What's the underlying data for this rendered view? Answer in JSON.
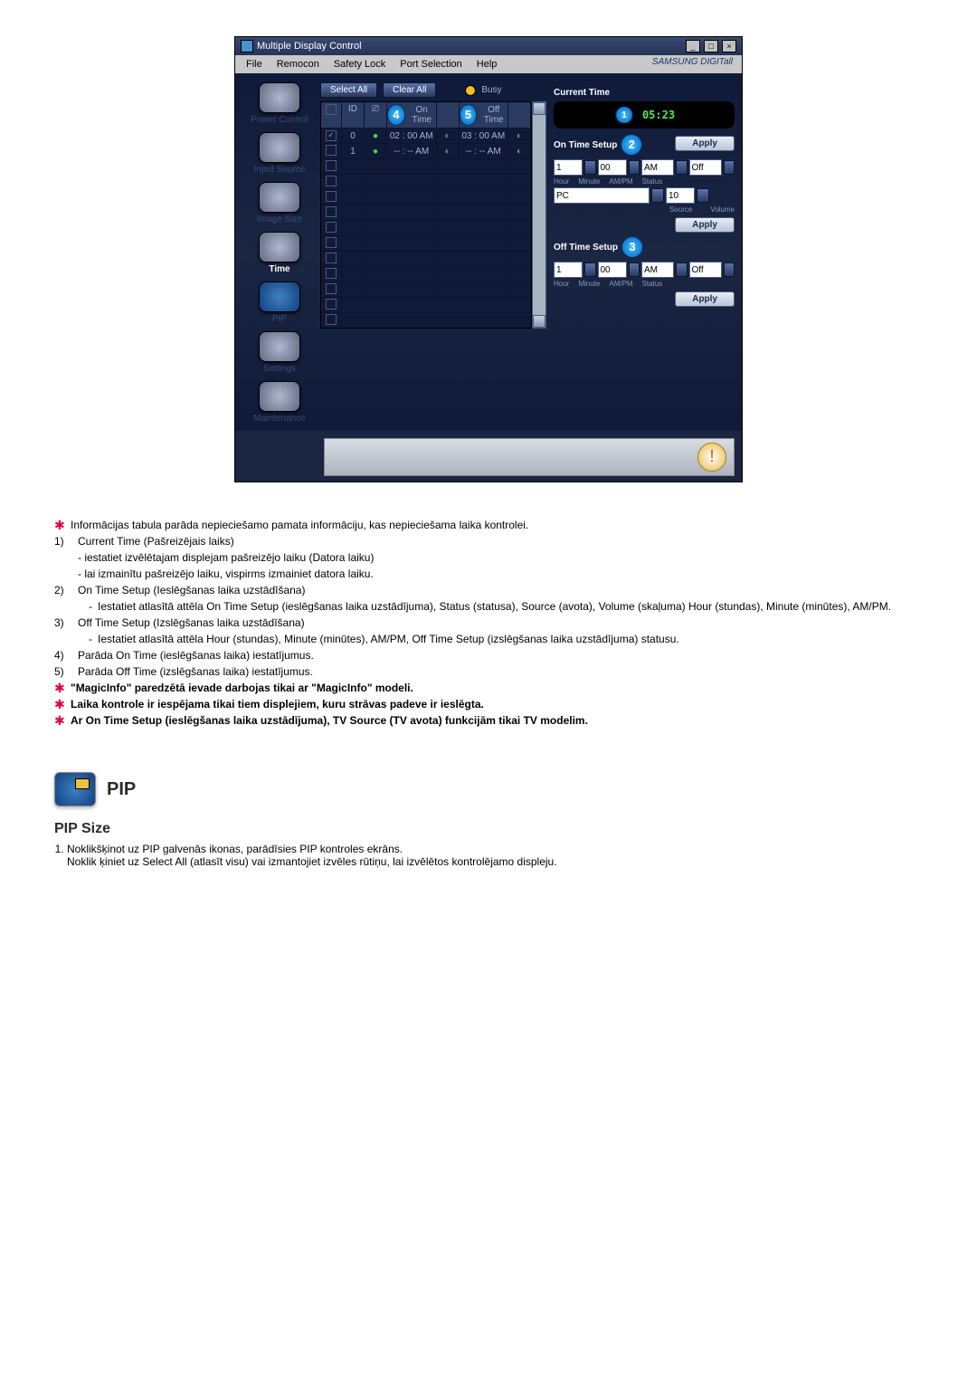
{
  "window": {
    "title": "Multiple Display Control",
    "menu": {
      "file": "File",
      "remocon": "Remocon",
      "safety": "Safety Lock",
      "port": "Port Selection",
      "help": "Help"
    },
    "brand": "SAMSUNG DIGITall"
  },
  "sidebar": {
    "power": "Power Control",
    "input": "Input Source",
    "image": "Image Size",
    "time": "Time",
    "pip": "PIP",
    "settings": "Settings",
    "maint": "Maintenance"
  },
  "top": {
    "selectAll": "Select All",
    "clearAll": "Clear All",
    "busy": "Busy",
    "head": {
      "id": "ID",
      "onTime": "On Time",
      "offTime": "Off Time"
    },
    "rows": [
      {
        "id": "0",
        "on": "02 : 00 AM",
        "off": "03 : 00 AM"
      },
      {
        "id": "1",
        "on": "-- : -- AM",
        "off": "-- : -- AM"
      }
    ]
  },
  "panel": {
    "currentTime": "Current Time",
    "time": "05:23",
    "apply": "Apply",
    "onSetup": "On Time Setup",
    "offSetup": "Off Time Setup",
    "hour": "Hour",
    "minute": "Minute",
    "ampm": "AM/PM",
    "status": "Status",
    "source": "Source",
    "volume": "Volume",
    "v": {
      "h": "1",
      "m": "00",
      "ap": "AM",
      "st": "Off",
      "src": "PC",
      "vol": "10"
    }
  },
  "doc": {
    "intro": "Informācijas tabula parāda nepieciešamo pamata informāciju, kas nepieciešama laika kontrolei.",
    "p1": {
      "n": "1)",
      "t": "Current Time (Pašreizējais laiks)",
      "s1": "- iestatiet izvēlētajam displejam pašreizējo laiku (Datora laiku)",
      "s2": "- lai izmainītu pašreizējo laiku, vispirms izmainiet datora laiku."
    },
    "p2": {
      "n": "2)",
      "t": "On Time Setup (Ieslēgšanas laika uzstādīšana)",
      "s": "Iestatiet atlasītā attēla On Time Setup (ieslēgšanas laika uzstādījuma), Status (statusa), Source (avota), Volume (skaļuma) Hour (stundas), Minute (minūtes), AM/PM."
    },
    "p3": {
      "n": "3)",
      "t": "Off Time Setup (Izslēgšanas laika uzstādīšana)",
      "s": "Iestatiet atlasītā attēla Hour (stundas), Minute (minūtes), AM/PM, Off Time Setup (izslēgšanas laika uzstādījuma) statusu."
    },
    "p4": {
      "n": "4)",
      "t": "Parāda On Time (ieslēgšanas laika) iestatījumus."
    },
    "p5": {
      "n": "5)",
      "t": "Parāda Off Time (izslēgšanas laika) iestatījumus."
    },
    "n1": "\"MagicInfo\" paredzētā ievade darbojas tikai ar \"MagicInfo\" modeli.",
    "n2": "Laika kontrole ir iespējama tikai tiem displejiem, kuru strāvas padeve ir ieslēgta.",
    "n3": "Ar On Time Setup (ieslēgšanas laika uzstādījuma), TV Source (TV avota) funkcijām tikai TV modelim.",
    "pipH": "PIP",
    "pipSub": "PIP Size",
    "pip1": "Noklikšķinot uz PIP galvenās ikonas, parādīsies PIP kontroles ekrāns.",
    "pip1b": "Noklik   ķiniet uz Select All (atlasīt visu) vai izmantojiet izvēles rūtiņu, lai izvēlētos kontrolējamo displeju."
  }
}
